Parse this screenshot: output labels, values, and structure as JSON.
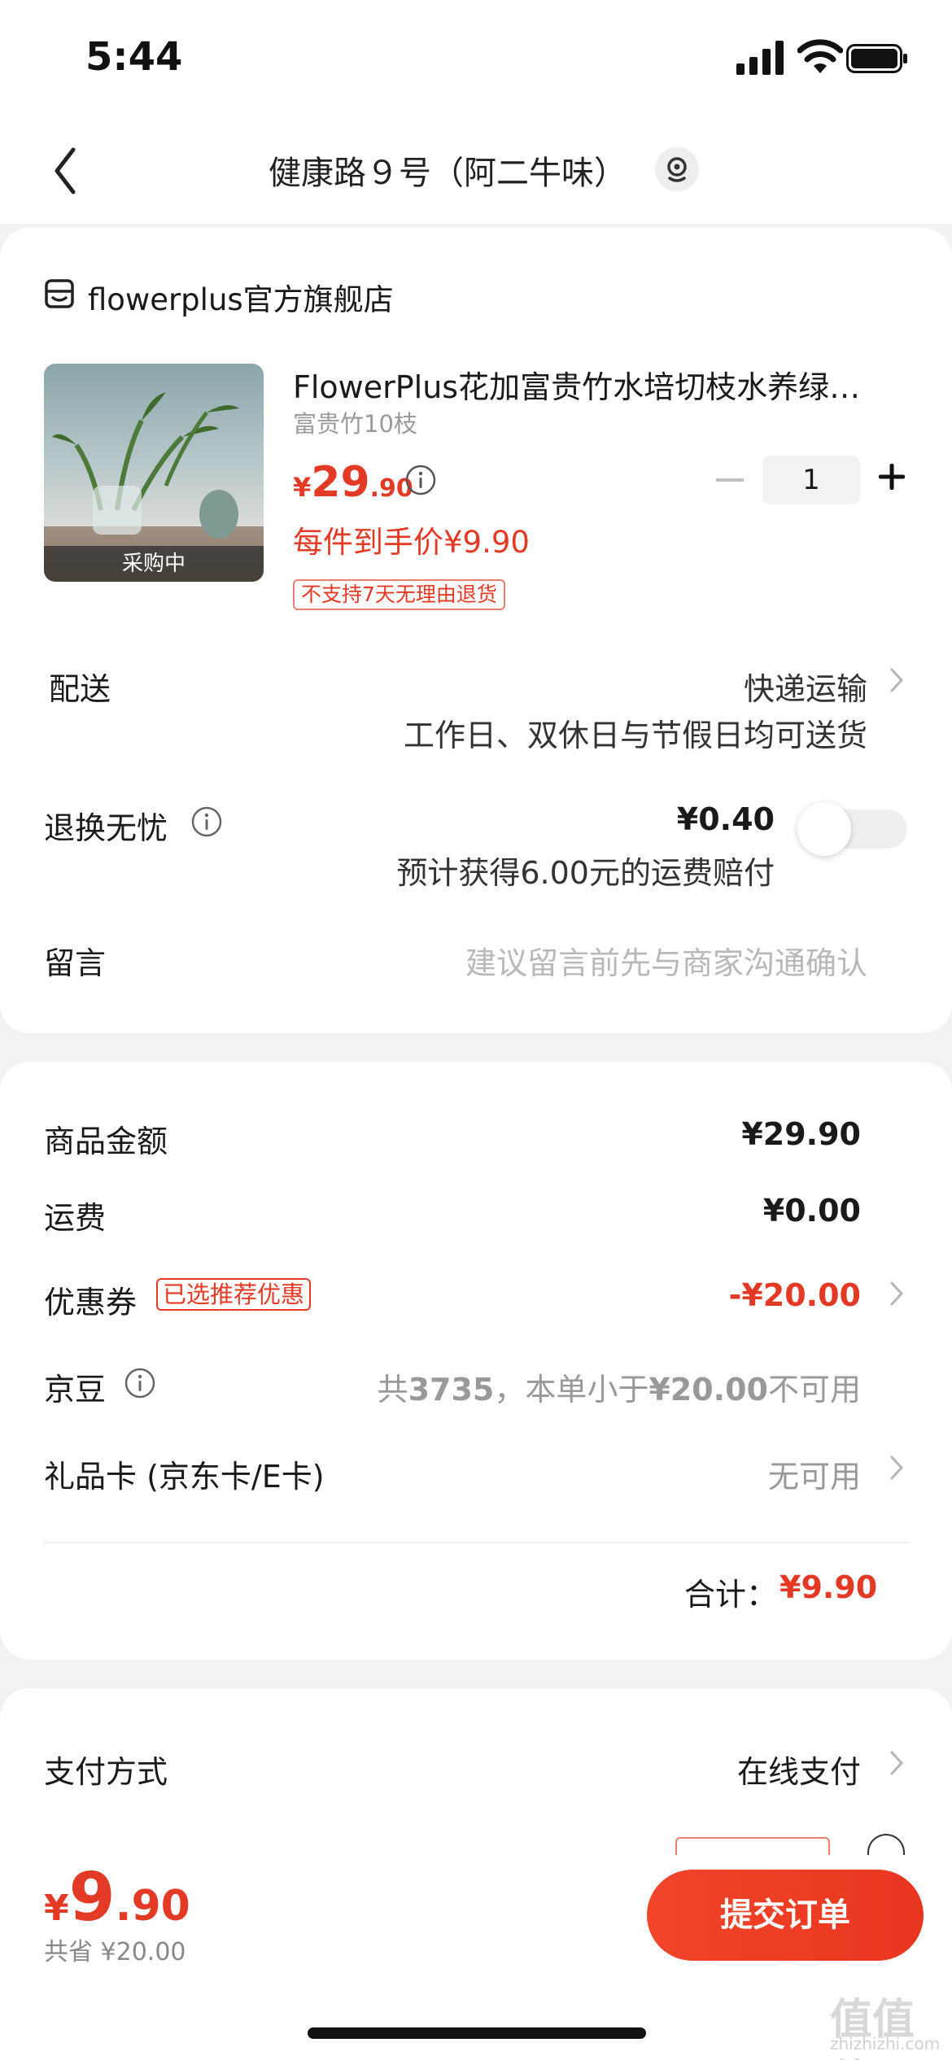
{
  "status_bar": {
    "time": "5:44"
  },
  "nav": {
    "title": "健康路９号（阿二牛味）"
  },
  "store": {
    "name": "flowerplus官方旗舰店"
  },
  "product": {
    "title": "FlowerPlus花加富贵竹水培切枝水养绿…",
    "spec": "富贵竹10枝",
    "price_symbol": "¥",
    "price_int": "29",
    "price_dec": ".90",
    "each_price": "每件到手价¥9.90",
    "return_tag": "不支持7天无理由退货",
    "image_badge": "采购中",
    "quantity": "1"
  },
  "delivery": {
    "label": "配送",
    "method": "快递运输",
    "note": "工作日、双休日与节假日均可送货"
  },
  "return_worry": {
    "label": "退换无忧",
    "price": "¥0.40",
    "note": "预计获得6.00元的运费赔付",
    "enabled": false
  },
  "message": {
    "label": "留言",
    "placeholder": "建议留言前先与商家沟通确认"
  },
  "summary": {
    "goods_label": "商品金额",
    "goods_value": "¥29.90",
    "shipping_label": "运费",
    "shipping_value": "¥0.00",
    "coupon_label": "优惠券",
    "coupon_tag": "已选推荐优惠",
    "coupon_value": "-¥20.00",
    "jingdou_label": "京豆",
    "jingdou_value_prefix": "共",
    "jingdou_count": "3735",
    "jingdou_value_mid": "，本单小于",
    "jingdou_limit": "¥20.00",
    "jingdou_value_suffix": "不可用",
    "giftcard_label": "礼品卡 (京东卡/E卡)",
    "giftcard_value": "无可用",
    "total_label": "合计：",
    "total_value": "¥9.90"
  },
  "payment": {
    "label": "支付方式",
    "value": "在线支付"
  },
  "bottom": {
    "symbol": "¥",
    "int": "9",
    "dec": ".90",
    "saved": "共省 ¥20.00",
    "submit": "提交订单"
  },
  "watermark": {
    "line1": "值值值",
    "line2": "zhizhizhi.com"
  },
  "colors": {
    "accent": "#e33a26",
    "background": "#f2f2f2",
    "card": "#ffffff"
  }
}
